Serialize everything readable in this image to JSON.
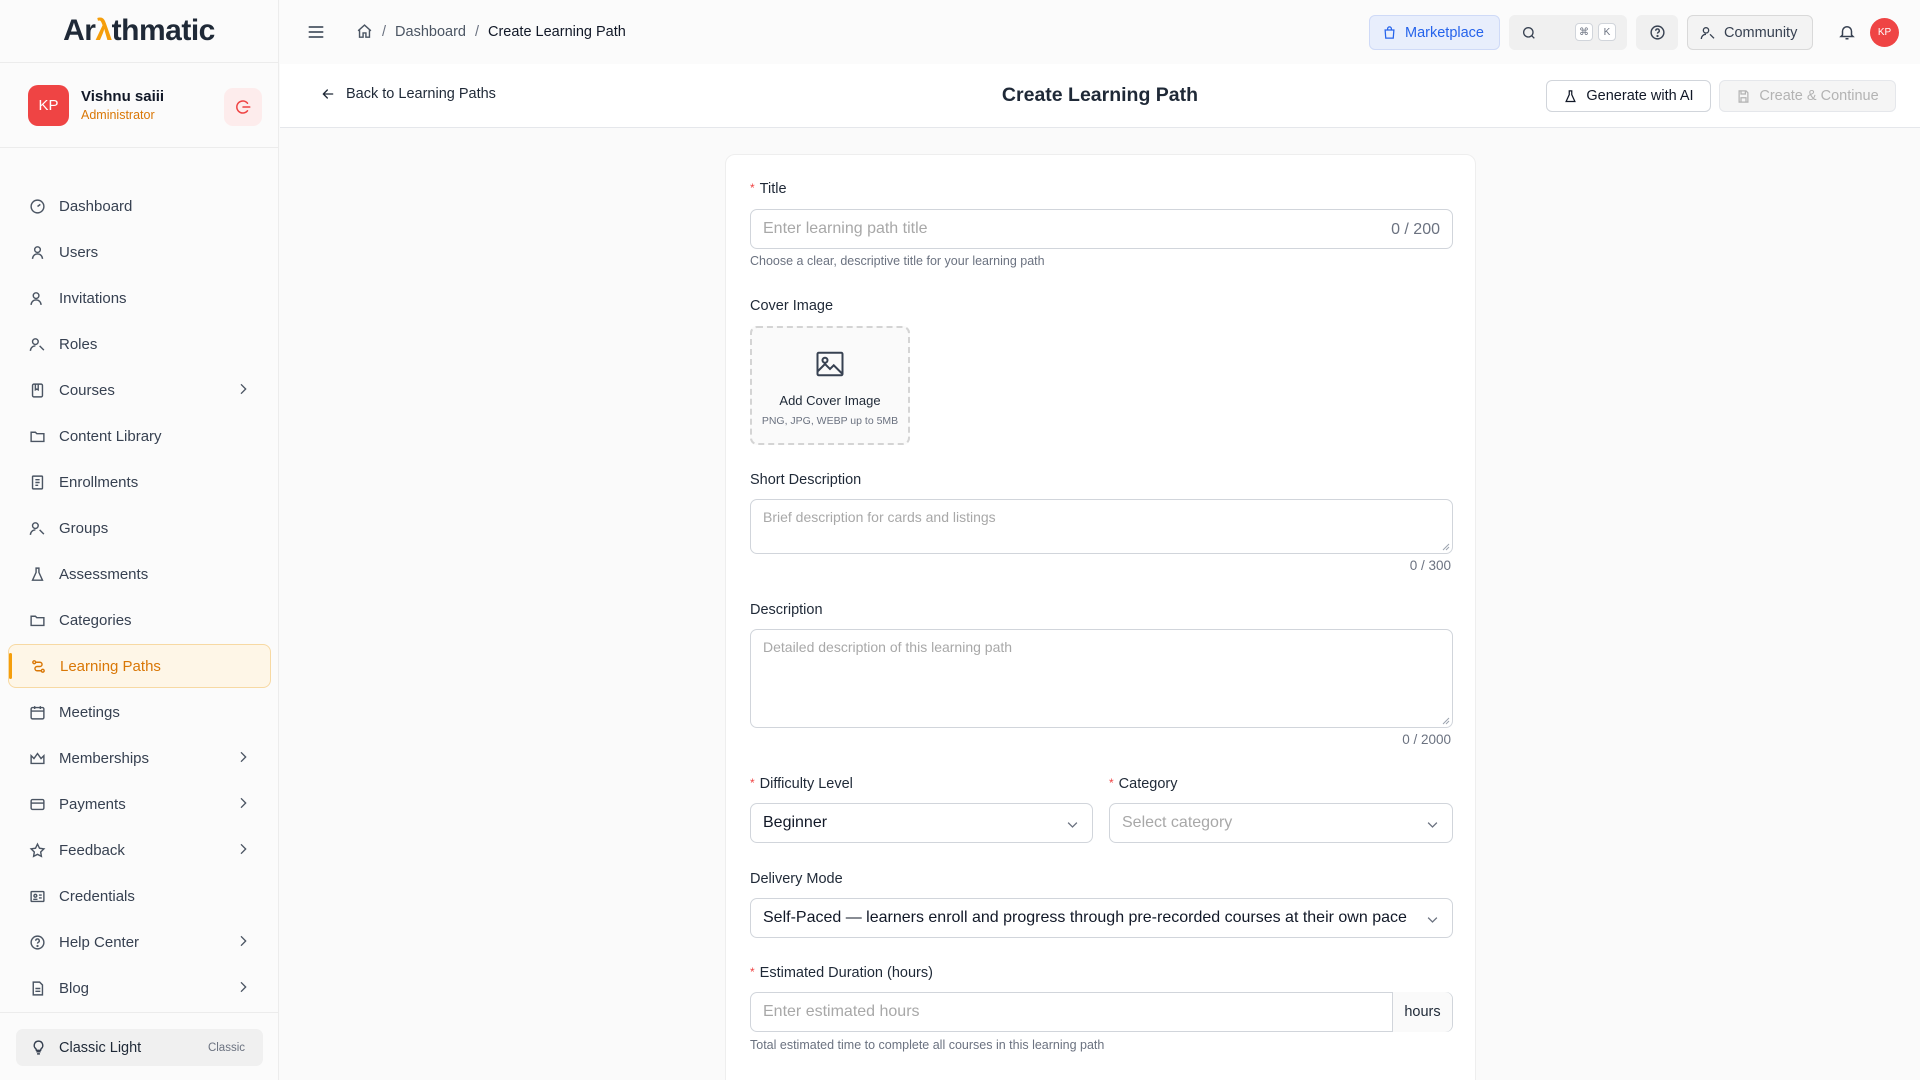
{
  "app": {
    "logo_pre": "Ar",
    "logo_mid": "λ",
    "logo_post": "thmatic"
  },
  "user": {
    "initials": "KP",
    "name": "Vishnu saiii",
    "role": "Administrator"
  },
  "sidebar": {
    "items": [
      {
        "label": "Dashboard"
      },
      {
        "label": "Users"
      },
      {
        "label": "Invitations"
      },
      {
        "label": "Roles"
      },
      {
        "label": "Courses"
      },
      {
        "label": "Content Library"
      },
      {
        "label": "Enrollments"
      },
      {
        "label": "Groups"
      },
      {
        "label": "Assessments"
      },
      {
        "label": "Categories"
      },
      {
        "label": "Learning Paths"
      },
      {
        "label": "Meetings"
      },
      {
        "label": "Memberships"
      },
      {
        "label": "Payments"
      },
      {
        "label": "Feedback"
      },
      {
        "label": "Credentials"
      },
      {
        "label": "Help Center"
      },
      {
        "label": "Blog"
      }
    ],
    "theme": {
      "label": "Classic Light",
      "badge": "Classic"
    }
  },
  "topbar": {
    "breadcrumb": {
      "home_sep": "/",
      "dashboard": "Dashboard",
      "sep": "/",
      "current": "Create Learning Path"
    },
    "marketplace": "Marketplace",
    "search_kbd_1": "⌘",
    "search_kbd_2": "K",
    "community": "Community",
    "avatar_initials": "KP"
  },
  "header": {
    "back": "Back to Learning Paths",
    "title": "Create Learning Path",
    "generate": "Generate with AI",
    "create": "Create & Continue"
  },
  "form": {
    "required_mark": "*",
    "title_label": "Title",
    "title_placeholder": "Enter learning path title",
    "title_counter": "0 / 200",
    "title_hint": "Choose a clear, descriptive title for your learning path",
    "cover_label": "Cover Image",
    "cover_add": "Add Cover Image",
    "cover_hint": "PNG, JPG, WEBP up to 5MB",
    "short_label": "Short Description",
    "short_placeholder": "Brief description for cards and listings",
    "short_counter": "0 / 300",
    "desc_label": "Description",
    "desc_placeholder": "Detailed description of this learning path",
    "desc_counter": "0 / 2000",
    "difficulty_label": "Difficulty Level",
    "difficulty_value": "Beginner",
    "category_label": "Category",
    "category_placeholder": "Select category",
    "delivery_label": "Delivery Mode",
    "delivery_value": "Self-Paced — learners enroll and progress through pre-recorded courses at their own pace",
    "duration_label": "Estimated Duration (hours)",
    "duration_placeholder": "Enter estimated hours",
    "duration_suffix": "hours",
    "duration_hint": "Total estimated time to complete all courses in this learning path"
  },
  "colors": {
    "accent": "#f59e0b",
    "brand_blue": "#2563eb",
    "danger": "#ef4444"
  }
}
